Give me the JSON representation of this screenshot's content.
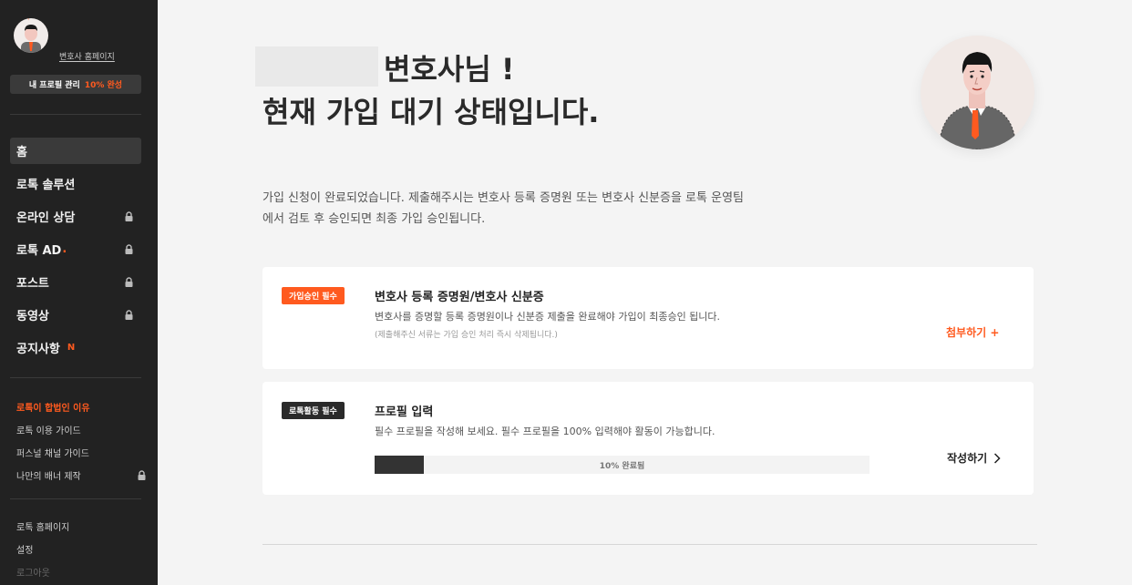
{
  "sidebar": {
    "homepage_link": "변호사 홈페이지",
    "profile_manage": {
      "label": "내 프로필 관리",
      "percent": "10% 완성"
    },
    "nav": [
      {
        "label": "홈",
        "active": true,
        "locked": false
      },
      {
        "label": "로톡 솔루션",
        "active": false,
        "locked": false
      },
      {
        "label": "온라인 상담",
        "active": false,
        "locked": true
      },
      {
        "label": "로톡 AD",
        "accent_dot": ".",
        "active": false,
        "locked": true
      },
      {
        "label": "포스트",
        "active": false,
        "locked": true
      },
      {
        "label": "동영상",
        "active": false,
        "locked": true
      },
      {
        "label": "공지사항",
        "badge": "N",
        "active": false,
        "locked": false
      }
    ],
    "sub_nav": [
      {
        "label": "로톡이 합법인 이유",
        "accent": true
      },
      {
        "label": "로톡 이용 가이드"
      },
      {
        "label": "퍼스널 채널 가이드"
      },
      {
        "label": "나만의 배너 제작",
        "locked": true
      }
    ],
    "footer": [
      {
        "label": "로톡 홈페이지"
      },
      {
        "label": "설정"
      },
      {
        "label": "로그아웃"
      }
    ]
  },
  "main": {
    "headline_line1": "변호사님 !",
    "headline_line2": "현재 가입 대기 상태입니다.",
    "description": "가입 신청이 완료되었습니다. 제출해주시는 변호사 등록 증명원 또는 변호사 신분증을 로톡 운영팀에서 검토 후 승인되면 최종 가입 승인됩니다.",
    "cards": [
      {
        "badge": "가입승인 필수",
        "title": "변호사 등록 증명원/변호사 신분증",
        "desc": "변호사를 증명할 등록 증명원이나 신분증 제출을 완료해야 가입이 최종승인 됩니다.",
        "note": "(제출해주신 서류는 가입 승인 처리 즉시 삭제됩니다.)",
        "action": "첨부하기 +"
      },
      {
        "badge": "로톡활동 필수",
        "title": "프로필 입력",
        "desc": "필수 프로필을 작성해 보세요. 필수 프로필을 100% 입력해야 활동이 가능합니다.",
        "progress": 0.1,
        "progress_label": "10% 완료됨",
        "action": "작성하기"
      }
    ]
  },
  "colors": {
    "accent": "#ff5a1f",
    "sidebar_bg": "#222222",
    "page_bg": "#f4f4f4"
  },
  "icons": [
    "avatar-illustration",
    "lock-icon",
    "chevron-right-icon"
  ]
}
